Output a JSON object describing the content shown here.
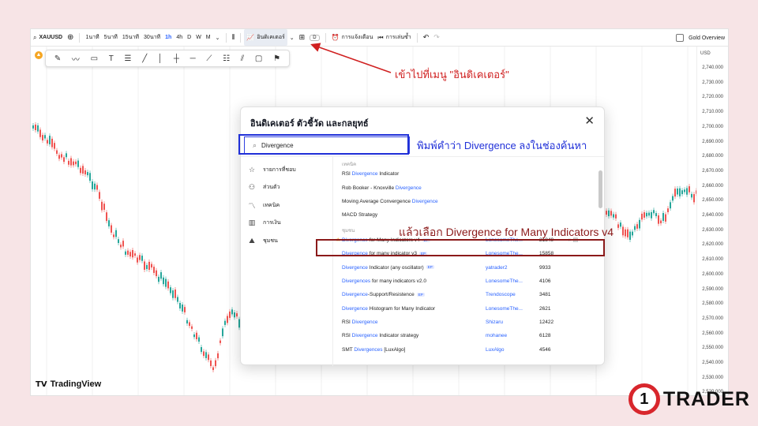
{
  "topbar": {
    "symbol": "XAUUSD",
    "intervals": [
      "1นาที",
      "5นาที",
      "15นาที",
      "30นาที",
      "1h",
      "4h",
      "D",
      "W",
      "M"
    ],
    "active_interval": "1h",
    "indicators_label": "อินดิเคเตอร์",
    "alert_label": "การแจ้งเตือน",
    "replay_label": "การเล่นซ้ำ",
    "layout_badge": "D",
    "compare_label": "Gold Overview"
  },
  "price_axis": {
    "currency": "USD",
    "ticks": [
      "2,740.000",
      "2,730.000",
      "2,720.000",
      "2,710.000",
      "2,700.000",
      "2,690.000",
      "2,680.000",
      "2,670.000",
      "2,660.000",
      "2,650.000",
      "2,640.000",
      "2,630.000",
      "2,620.000",
      "2,610.000",
      "2,600.000",
      "2,590.000",
      "2,580.000",
      "2,570.000",
      "2,560.000",
      "2,550.000",
      "2,540.000",
      "2,530.000",
      "2,520.000"
    ]
  },
  "branding": {
    "tv_logo": "TradingView",
    "corner_number": "1",
    "corner_name": "TRADER"
  },
  "dialog": {
    "title": "อินดิเคเตอร์ ตัวชี้วัด และกลยุทธ์",
    "search_value": "Divergence",
    "sidebar": [
      {
        "icon": "star-icon",
        "label": "รายการที่ชอบ"
      },
      {
        "icon": "user-icon",
        "label": "ส่วนตัว"
      },
      {
        "icon": "technical-icon",
        "label": "เทคนิค"
      },
      {
        "icon": "finance-icon",
        "label": "การเงิน"
      },
      {
        "icon": "community-icon",
        "label": "ชุมชน"
      }
    ],
    "technical_header": "เทคนิค",
    "technical_results": [
      {
        "pre": "RSI ",
        "hl": "Divergence",
        "post": " Indicator"
      },
      {
        "pre": "Rob Booker - Knoxville ",
        "hl": "Divergence",
        "post": ""
      },
      {
        "pre": "Moving Average Convergence ",
        "hl": "Divergence",
        "post": ""
      },
      {
        "pre": "MACD Strategy",
        "hl": "",
        "post": ""
      }
    ],
    "community_header": "ชุมชน",
    "community_results": [
      {
        "pre": "",
        "hl": "Divergence",
        "post": " for Many Indicators v4",
        "ep": "EP",
        "author": "LonesomeThe...",
        "count": "21849",
        "star": true
      },
      {
        "pre": "",
        "hl": "Divergence",
        "post": " for many indicator v3",
        "ep": "EP",
        "author": "LonesomeThe...",
        "count": "15858"
      },
      {
        "pre": "",
        "hl": "Divergence",
        "post": " Indicator (any oscillator)",
        "ep": "EP",
        "author": "yatrader2",
        "count": "9933"
      },
      {
        "pre": "",
        "hl": "Divergences",
        "post": " for many indicators v2.0",
        "ep": "",
        "author": "LonesomeThe...",
        "count": "4106"
      },
      {
        "pre": "",
        "hl": "Divergence",
        "post": "-Support/Resistence",
        "ep": "EP",
        "author": "Trendoscope",
        "count": "3481"
      },
      {
        "pre": "",
        "hl": "Divergence",
        "post": " Histogram for Many Indicator",
        "ep": "",
        "author": "LonesomeThe...",
        "count": "2621"
      },
      {
        "pre": "RSI ",
        "hl": "Divergence",
        "post": "",
        "ep": "",
        "author": "Shizaru",
        "count": "12422"
      },
      {
        "pre": "RSI ",
        "hl": "Divergence",
        "post": " Indicator strategy",
        "ep": "",
        "author": "mohanee",
        "count": "6128"
      },
      {
        "pre": "SMT ",
        "hl": "Divergences",
        "post": " [LuxAlgo]",
        "ep": "",
        "author": "LuxAlgo",
        "count": "4546"
      }
    ]
  },
  "annotations": {
    "step1": "เข้าไปที่เมนู \"อินดิเคเตอร์\"",
    "step2": "พิมพ์คำว่า Divergence ลงในช่องค้นหา",
    "step3": "แล้วเลือก Divergence for Many Indicators v4"
  },
  "colors": {
    "accent": "#2962ff",
    "annotation_red": "#d02020",
    "annotation_blue": "#2030d8",
    "up": "#26a69a",
    "down": "#ef5350"
  }
}
